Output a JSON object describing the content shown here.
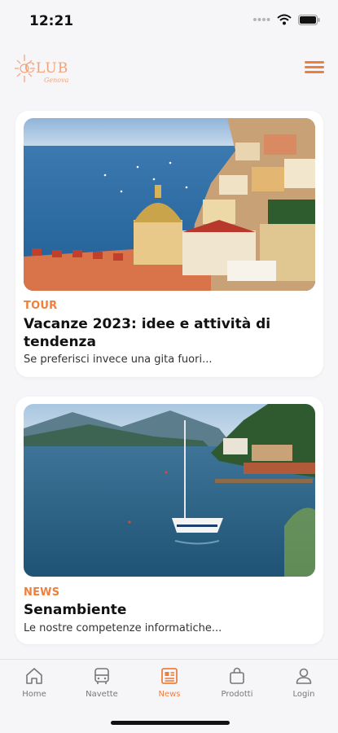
{
  "status": {
    "time": "12:21"
  },
  "header": {
    "logo_text": "CLUB",
    "logo_sub": "Genova",
    "accent": "#f07f3c"
  },
  "cards": [
    {
      "category": "TOUR",
      "title": "Vacanze 2023: idee e attività di tendenza",
      "excerpt": "Se preferisci invece una gita fuori..."
    },
    {
      "category": "NEWS",
      "title": "Senambiente",
      "excerpt": "Le nostre competenze informatiche..."
    }
  ],
  "tabs": [
    {
      "label": "Home",
      "icon": "home-icon",
      "active": false
    },
    {
      "label": "Navette",
      "icon": "bus-icon",
      "active": false
    },
    {
      "label": "News",
      "icon": "news-icon",
      "active": true
    },
    {
      "label": "Prodotti",
      "icon": "bag-icon",
      "active": false
    },
    {
      "label": "Login",
      "icon": "user-icon",
      "active": false
    }
  ]
}
